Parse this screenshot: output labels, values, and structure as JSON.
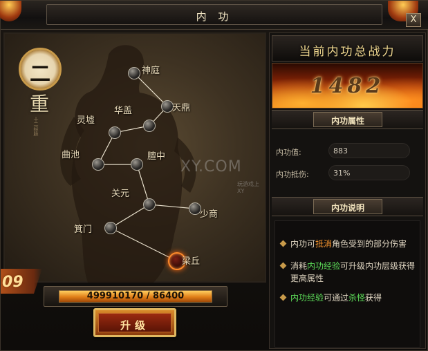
{
  "window": {
    "title": "内 功",
    "close_label": "X"
  },
  "meridian": {
    "rank_number": "二",
    "rank_unit": "重",
    "side_text": "十二经脉",
    "watermark": "XY.COM",
    "watermark_sub": "玩游戏上XY",
    "nodes": [
      {
        "id": "shenting",
        "label": "神庭",
        "active": false
      },
      {
        "id": "tianding",
        "label": "天鼎",
        "active": false
      },
      {
        "id": "huagai",
        "label": "华盖",
        "active": false
      },
      {
        "id": "lingxu",
        "label": "灵墟",
        "active": false
      },
      {
        "id": "quchi",
        "label": "曲池",
        "active": false
      },
      {
        "id": "danzhong",
        "label": "膻中",
        "active": false
      },
      {
        "id": "guanyuan",
        "label": "关元",
        "active": false
      },
      {
        "id": "shaoshang",
        "label": "少商",
        "active": false
      },
      {
        "id": "jimen",
        "label": "箕门",
        "active": false
      },
      {
        "id": "liangqiu",
        "label": "梁丘",
        "active": true
      }
    ]
  },
  "level_tab": {
    "value": "09"
  },
  "exp": {
    "current": 499910170,
    "max": 86400,
    "text": "499910170 / 86400",
    "fill_fraction": 1.0
  },
  "upgrade": {
    "label": "升级"
  },
  "power": {
    "header": "当前内功总战力",
    "value": "1482"
  },
  "attributes": {
    "header": "内功属性",
    "rows": [
      {
        "label": "内功值:",
        "value": "883"
      },
      {
        "label": "内功抵伤:",
        "value": "31%"
      }
    ]
  },
  "description": {
    "header": "内功说明",
    "items": [
      {
        "parts": [
          {
            "t": "内功可",
            "c": ""
          },
          {
            "t": "抵消",
            "c": "orange"
          },
          {
            "t": "角色受到的部分伤害",
            "c": ""
          }
        ]
      },
      {
        "parts": [
          {
            "t": "消耗",
            "c": ""
          },
          {
            "t": "内功经验",
            "c": "green"
          },
          {
            "t": "可升级内功层级获得更高属性",
            "c": ""
          }
        ]
      },
      {
        "parts": [
          {
            "t": "内功经验",
            "c": "green"
          },
          {
            "t": "可通过",
            "c": ""
          },
          {
            "t": "杀怪",
            "c": "green"
          },
          {
            "t": "获得",
            "c": ""
          }
        ]
      }
    ]
  },
  "colors": {
    "accent": "#ff9a30",
    "highlight_green": "#5ee05a",
    "gold": "#f0d890"
  }
}
